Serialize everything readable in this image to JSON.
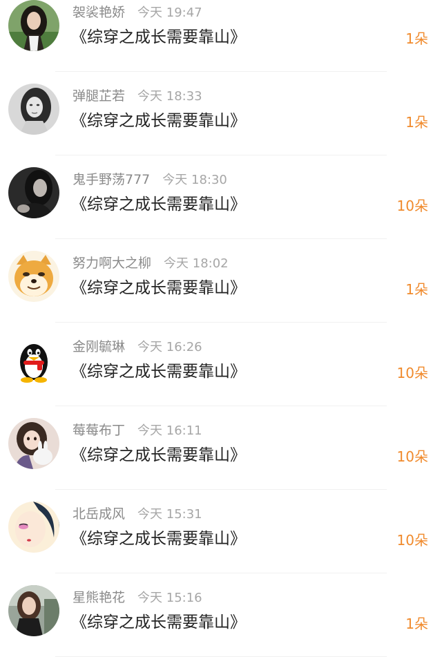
{
  "gift_list": {
    "items": [
      {
        "name": "袈裟艳娇",
        "day": "今天",
        "time": "19:47",
        "title": "《综穿之成长需要靠山》",
        "amount": "1朵",
        "avatar": "woman-dark-hair-avatar"
      },
      {
        "name": "弹腿芷若",
        "day": "今天",
        "time": "18:33",
        "title": "《综穿之成长需要靠山》",
        "amount": "1朵",
        "avatar": "bw-woman-portrait-avatar"
      },
      {
        "name": "鬼手野荡777",
        "day": "今天",
        "time": "18:30",
        "title": "《综穿之成长需要靠山》",
        "amount": "10朵",
        "avatar": "dark-portrait-avatar"
      },
      {
        "name": "努力啊大之柳",
        "day": "今天",
        "time": "18:02",
        "title": "《综穿之成长需要靠山》",
        "amount": "1朵",
        "avatar": "shiba-dog-avatar"
      },
      {
        "name": "金刚毓琳",
        "day": "今天",
        "time": "16:26",
        "title": "《综穿之成长需要靠山》",
        "amount": "10朵",
        "avatar": "qq-penguin-avatar"
      },
      {
        "name": "莓莓布丁",
        "day": "今天",
        "time": "16:11",
        "title": "《综穿之成长需要靠山》",
        "amount": "10朵",
        "avatar": "girl-with-bunny-avatar"
      },
      {
        "name": "北岳成风",
        "day": "今天",
        "time": "15:31",
        "title": "《综穿之成长需要靠山》",
        "amount": "10朵",
        "avatar": "painted-face-avatar"
      },
      {
        "name": "星熊艳花",
        "day": "今天",
        "time": "15:16",
        "title": "《综穿之成长需要靠山》",
        "amount": "1朵",
        "avatar": "woman-outdoor-avatar"
      }
    ]
  },
  "colors": {
    "amount_orange": "#f08a2c",
    "name_gray": "#8a8a8a",
    "time_gray": "#a6a6a6",
    "title_black": "#222222"
  }
}
